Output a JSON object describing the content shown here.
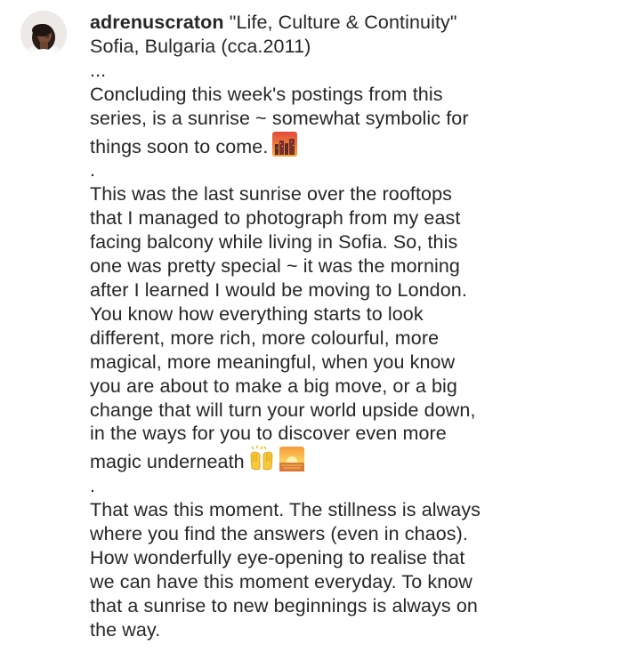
{
  "post": {
    "username": "adrenuscraton",
    "title": "\"Life, Culture & Continuity\"",
    "location_line": "Sofia, Bulgaria (cca.2011)",
    "ellipsis": "...",
    "para1": [
      "Concluding this week's postings from this",
      "series, is a sunrise ~ somewhat symbolic for",
      "things soon to come."
    ],
    "dot1": ".",
    "para2": [
      "This was the last sunrise over the rooftops",
      "that I managed to photograph from my east",
      "facing balcony while living in Sofia. So, this",
      "one was pretty special ~ it was the morning",
      "after I learned I would be moving to London.",
      "You know how everything starts to look",
      "different, more rich, more colourful, more",
      "magical, more meaningful, when you know",
      "you are about to make a big move, or a big",
      "change that will turn your world upside down,",
      "in the ways for you to discover even more",
      "magic underneath"
    ],
    "dot2": ".",
    "para3": [
      "That was this moment. The stillness is always",
      "where you find the answers (even in chaos).",
      "How wonderfully eye-opening to realise that",
      "we can have this moment everyday. To know",
      "that a sunrise to new beginnings is always on",
      "the way."
    ],
    "icons": {
      "avatar": "profile-photo",
      "emoji_1": "city-sunset-emoji",
      "emoji_2": "raised-hands-emoji",
      "emoji_3": "sunrise-emoji"
    }
  }
}
